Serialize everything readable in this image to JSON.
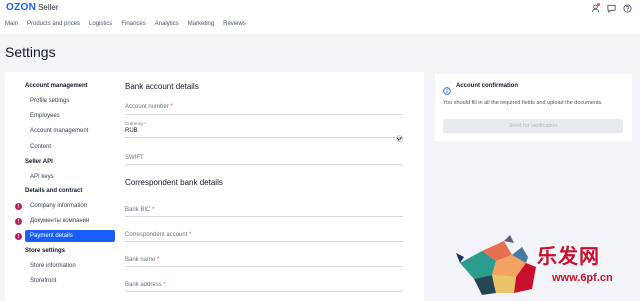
{
  "header": {
    "logo_brand": "OZON",
    "logo_product": "Seller",
    "nav": [
      "Main",
      "Products and prices",
      "Logistics",
      "Finances",
      "Analytics",
      "Marketing",
      "Reviews"
    ]
  },
  "page": {
    "title": "Settings"
  },
  "sidebar": {
    "account_management_heading": "Account management",
    "profile_settings": "Profile settings",
    "employees": "Employees",
    "account_management": "Account management",
    "content": "Content",
    "seller_api_heading": "Seller API",
    "api_keys": "API keys",
    "details_heading": "Details and contract",
    "company_information": "Company information",
    "company_documents": "Документы компании",
    "payment_details": "Payment details",
    "store_settings_heading": "Store settings",
    "store_information": "Store information",
    "storefront": "Storefront",
    "badge": "!"
  },
  "form": {
    "bank_section_title": "Bank account details",
    "account_number_label": "Account number",
    "currency_label": "Currency",
    "currency_value": "RUB",
    "swift_label": "SWIFT",
    "correspondent_section_title": "Correspondent bank details",
    "bank_bic_label": "Bank BIC",
    "correspondent_account_label": "Correspondent account",
    "bank_name_label": "Bank name",
    "bank_address_label": "Bank address",
    "required_mark": "*"
  },
  "confirmation": {
    "title": "Account confirmation",
    "text": "You should fill in all the required fields and upload the documents.",
    "button": "Send for verification"
  },
  "watermark": {
    "text": "乐发网",
    "url": "www.6pf.cn"
  },
  "colors": {
    "accent": "#1a5df5",
    "badge": "#b3205e",
    "required": "#e5534b",
    "watermark": "#c8102e"
  }
}
